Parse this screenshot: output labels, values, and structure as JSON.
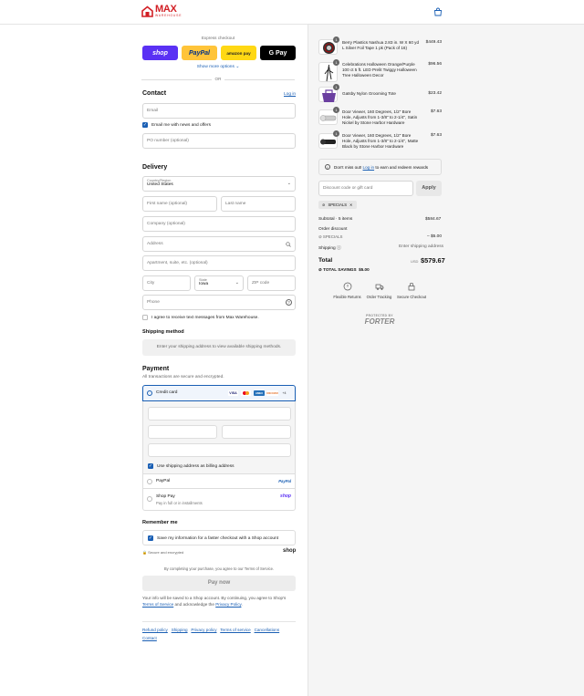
{
  "header": {
    "brand": "MAX",
    "brand_sub": "WAREHOUSE"
  },
  "express": {
    "label": "Express checkout",
    "shop_label": "shop",
    "paypal_label": "PayPal",
    "amazon_label": "amazon pay",
    "gpay_label": "G Pay",
    "more": "Show more options",
    "or": "OR"
  },
  "contact": {
    "title": "Contact",
    "login": "Log in",
    "email_placeholder": "Email",
    "news_label": "Email me with news and offers",
    "po_placeholder": "PO number (optional)"
  },
  "delivery": {
    "title": "Delivery",
    "country_label": "Country/Region",
    "country_value": "United States",
    "first_name": "First name (optional)",
    "last_name": "Last name",
    "company": "Company (optional)",
    "address": "Address",
    "apartment": "Apartment, suite, etc. (optional)",
    "city": "City",
    "state_label": "State",
    "state_value": "Iowa",
    "zip": "ZIP code",
    "phone": "Phone",
    "sms_label": "I agree to receive text messages from Max Warehouse."
  },
  "shipping": {
    "title": "Shipping method",
    "notice": "Enter your shipping address to view available shipping methods."
  },
  "payment": {
    "title": "Payment",
    "subtitle": "All transactions are secure and encrypted.",
    "credit_card": "Credit card",
    "cards": [
      "VISA",
      "MC",
      "AMEX",
      "DISCOVER",
      "+4"
    ],
    "billing_same": "Use shipping address as billing address",
    "paypal": "PayPal",
    "paypal_logo": "PayPal",
    "shoppay": "Shop Pay",
    "shoppay_sub": "Pay in full or in installments",
    "shoppay_logo": "shop"
  },
  "remember": {
    "title": "Remember me",
    "save_label": "Save my information for a faster checkout with a Shop account",
    "secure": "Secure and encrypted",
    "shop_logo": "shop"
  },
  "terms_note": "By completing your purchase, you agree to our Terms of Service.",
  "pay_button": "Pay now",
  "shop_notice": {
    "line1": "Your info will be saved to a Shop account. By continuing, you agree to Shop's",
    "tos": "Terms of Service",
    "mid": "and acknowledge the",
    "privacy": "Privacy Policy",
    "end": "."
  },
  "footer_links": [
    "Refund policy",
    "Shipping",
    "Privacy policy",
    "Terms of service",
    "Cancellations",
    "Contact"
  ],
  "cart": {
    "items": [
      {
        "qty": "1",
        "name": "Berry Plastics Nashua 2.83 in. W X 60 yd L Silver Foil Tape 1 pk (Pack of 16)",
        "price": "$449.43"
      },
      {
        "qty": "1",
        "name": "Celebrations Halloween Orange/Purple 100 ct 5 ft. LED Prelit Twiggy Halloween Tree Halloween Decor",
        "price": "$96.56"
      },
      {
        "qty": "1",
        "name": "Gatsby Nylon Grooming Tote",
        "price": "$23.42"
      },
      {
        "qty": "1",
        "name": "Door Viewer, 160 Degrees, 1/2\" Bore Hole, Adjusts from 1-3/8\" to 2-1/4\", Satin Nickel by Stone Harbor Hardware",
        "price": "$7.63"
      },
      {
        "qty": "1",
        "name": "Door Viewer, 160 Degrees, 1/2\" Bore Hole, Adjusts from 1-3/8\" to 2-1/4\", Matte Black by Stone Harbor Hardware",
        "price": "$7.63"
      }
    ],
    "rewards_pre": "Don't miss out!",
    "rewards_login": "Log in",
    "rewards_post": "to earn and redeem rewards",
    "discount_placeholder": "Discount code or gift card",
    "apply": "Apply",
    "code_tag": "SPECIALS",
    "subtotal_label": "Subtotal · 5 items",
    "subtotal_value": "$584.67",
    "order_discount": "Order discount",
    "discount_code": "SPECIALS",
    "discount_value": "– $5.00",
    "shipping_label": "Shipping",
    "shipping_value": "Enter shipping address",
    "total_label": "Total",
    "currency": "USD",
    "total_value": "$579.67",
    "savings_label": "TOTAL SAVINGS",
    "savings_value": "$5.00",
    "trust": [
      "Flexible Returns",
      "Order Tracking",
      "Secure Checkout"
    ],
    "forter_top": "PROTECTED BY",
    "forter": "FORTER"
  },
  "colors": {
    "brand": "#d21f25",
    "link": "#1a5fb4",
    "shop": "#5a31f4",
    "paypal": "#ffc439",
    "amazon": "#ffd814"
  }
}
